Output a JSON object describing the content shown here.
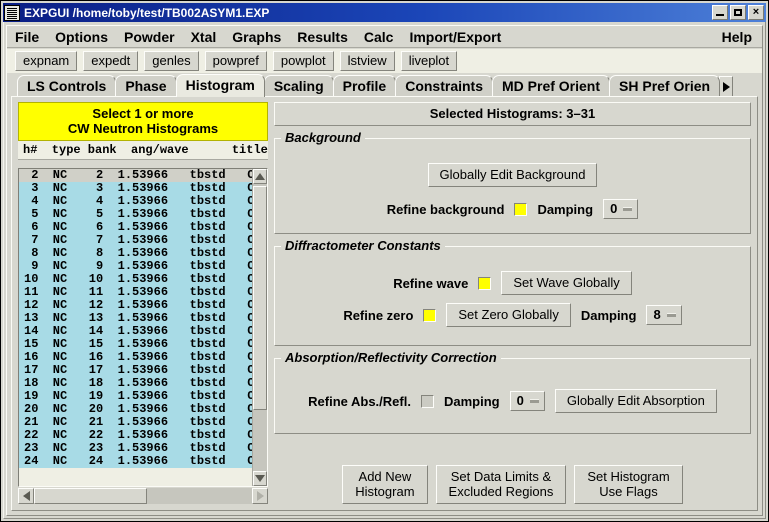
{
  "window": {
    "title": "EXPGUI /home/toby/test/TB002ASYM1.EXP",
    "icon": "document-lines-icon",
    "minimize_label": "_",
    "maximize_label": "□",
    "close_label": "×",
    "titlebar_color": "#1b46b8"
  },
  "menubar": {
    "items": [
      {
        "label": "File"
      },
      {
        "label": "Options"
      },
      {
        "label": "Powder"
      },
      {
        "label": "Xtal"
      },
      {
        "label": "Graphs"
      },
      {
        "label": "Results"
      },
      {
        "label": "Calc"
      },
      {
        "label": "Import/Export"
      }
    ],
    "help_label": "Help"
  },
  "toolbar": {
    "buttons": [
      {
        "label": "expnam"
      },
      {
        "label": "expedt"
      },
      {
        "label": "genles"
      },
      {
        "label": "powpref"
      },
      {
        "label": "powplot"
      },
      {
        "label": "lstview"
      },
      {
        "label": "liveplot"
      }
    ]
  },
  "tabs": {
    "items": [
      {
        "label": "LS Controls",
        "active": false
      },
      {
        "label": "Phase",
        "active": false
      },
      {
        "label": "Histogram",
        "active": true
      },
      {
        "label": "Scaling",
        "active": false
      },
      {
        "label": "Profile",
        "active": false
      },
      {
        "label": "Constraints",
        "active": false
      },
      {
        "label": "MD Pref Orient",
        "active": false
      },
      {
        "label": "SH Pref Orien",
        "active": false
      }
    ],
    "scroll_right_icon": "chevron-right-icon"
  },
  "histogram_list": {
    "banner_line1": "Select 1 or more",
    "banner_line2": "CW Neutron Histograms",
    "banner_color": "#ffff00",
    "header": "h#  type bank  ang/wave      title",
    "selection_color": "#a8dbe6",
    "rows": [
      {
        "h": "2",
        "type": "NC",
        "bank": "2",
        "angwave": "1.53966",
        "title": "tbstd   Cu",
        "selected": false
      },
      {
        "h": "3",
        "type": "NC",
        "bank": "3",
        "angwave": "1.53966",
        "title": "tbstd   Cu",
        "selected": true
      },
      {
        "h": "4",
        "type": "NC",
        "bank": "4",
        "angwave": "1.53966",
        "title": "tbstd   Cu",
        "selected": true
      },
      {
        "h": "5",
        "type": "NC",
        "bank": "5",
        "angwave": "1.53966",
        "title": "tbstd   Cu",
        "selected": true
      },
      {
        "h": "6",
        "type": "NC",
        "bank": "6",
        "angwave": "1.53966",
        "title": "tbstd   Cu",
        "selected": true
      },
      {
        "h": "7",
        "type": "NC",
        "bank": "7",
        "angwave": "1.53966",
        "title": "tbstd   Cu",
        "selected": true
      },
      {
        "h": "8",
        "type": "NC",
        "bank": "8",
        "angwave": "1.53966",
        "title": "tbstd   Cu",
        "selected": true
      },
      {
        "h": "9",
        "type": "NC",
        "bank": "9",
        "angwave": "1.53966",
        "title": "tbstd   Cu",
        "selected": true
      },
      {
        "h": "10",
        "type": "NC",
        "bank": "10",
        "angwave": "1.53966",
        "title": "tbstd   Cu",
        "selected": true
      },
      {
        "h": "11",
        "type": "NC",
        "bank": "11",
        "angwave": "1.53966",
        "title": "tbstd   Cu",
        "selected": true
      },
      {
        "h": "12",
        "type": "NC",
        "bank": "12",
        "angwave": "1.53966",
        "title": "tbstd   Cu",
        "selected": true
      },
      {
        "h": "13",
        "type": "NC",
        "bank": "13",
        "angwave": "1.53966",
        "title": "tbstd   Cu",
        "selected": true
      },
      {
        "h": "14",
        "type": "NC",
        "bank": "14",
        "angwave": "1.53966",
        "title": "tbstd   Cu",
        "selected": true
      },
      {
        "h": "15",
        "type": "NC",
        "bank": "15",
        "angwave": "1.53966",
        "title": "tbstd   Cu",
        "selected": true
      },
      {
        "h": "16",
        "type": "NC",
        "bank": "16",
        "angwave": "1.53966",
        "title": "tbstd   Cu",
        "selected": true
      },
      {
        "h": "17",
        "type": "NC",
        "bank": "17",
        "angwave": "1.53966",
        "title": "tbstd   Cu",
        "selected": true
      },
      {
        "h": "18",
        "type": "NC",
        "bank": "18",
        "angwave": "1.53966",
        "title": "tbstd   Cu",
        "selected": true
      },
      {
        "h": "19",
        "type": "NC",
        "bank": "19",
        "angwave": "1.53966",
        "title": "tbstd   Cu",
        "selected": true
      },
      {
        "h": "20",
        "type": "NC",
        "bank": "20",
        "angwave": "1.53966",
        "title": "tbstd   Cu",
        "selected": true
      },
      {
        "h": "21",
        "type": "NC",
        "bank": "21",
        "angwave": "1.53966",
        "title": "tbstd   Cu",
        "selected": true
      },
      {
        "h": "22",
        "type": "NC",
        "bank": "22",
        "angwave": "1.53966",
        "title": "tbstd   Cu",
        "selected": true
      },
      {
        "h": "23",
        "type": "NC",
        "bank": "23",
        "angwave": "1.53966",
        "title": "tbstd   Cu",
        "selected": true
      },
      {
        "h": "24",
        "type": "NC",
        "bank": "24",
        "angwave": "1.53966",
        "title": "tbstd   Cu",
        "selected": true
      }
    ]
  },
  "panel": {
    "selected_histograms": "Selected Histograms: 3–31",
    "background": {
      "group_label": "Background",
      "edit_button": "Globally Edit Background",
      "refine_label": "Refine background",
      "refine_checked": true,
      "damping_label": "Damping",
      "damping_value": "0"
    },
    "diffractometer": {
      "group_label": "Diffractometer Constants",
      "refine_wave_label": "Refine wave",
      "refine_wave_checked": true,
      "set_wave_button": "Set Wave Globally",
      "refine_zero_label": "Refine zero",
      "refine_zero_checked": true,
      "set_zero_button": "Set Zero Globally",
      "damping_label": "Damping",
      "damping_value": "8"
    },
    "absorption": {
      "group_label": "Absorption/Reflectivity Correction",
      "refine_label": "Refine Abs./Refl.",
      "refine_checked": false,
      "damping_label": "Damping",
      "damping_value": "0",
      "edit_button": "Globally Edit Absorption"
    },
    "bottom_buttons": [
      {
        "line1": "Add New",
        "line2": "Histogram"
      },
      {
        "line1": "Set Data Limits &",
        "line2": "Excluded Regions"
      },
      {
        "line1": "Set Histogram",
        "line2": "Use Flags"
      }
    ]
  }
}
